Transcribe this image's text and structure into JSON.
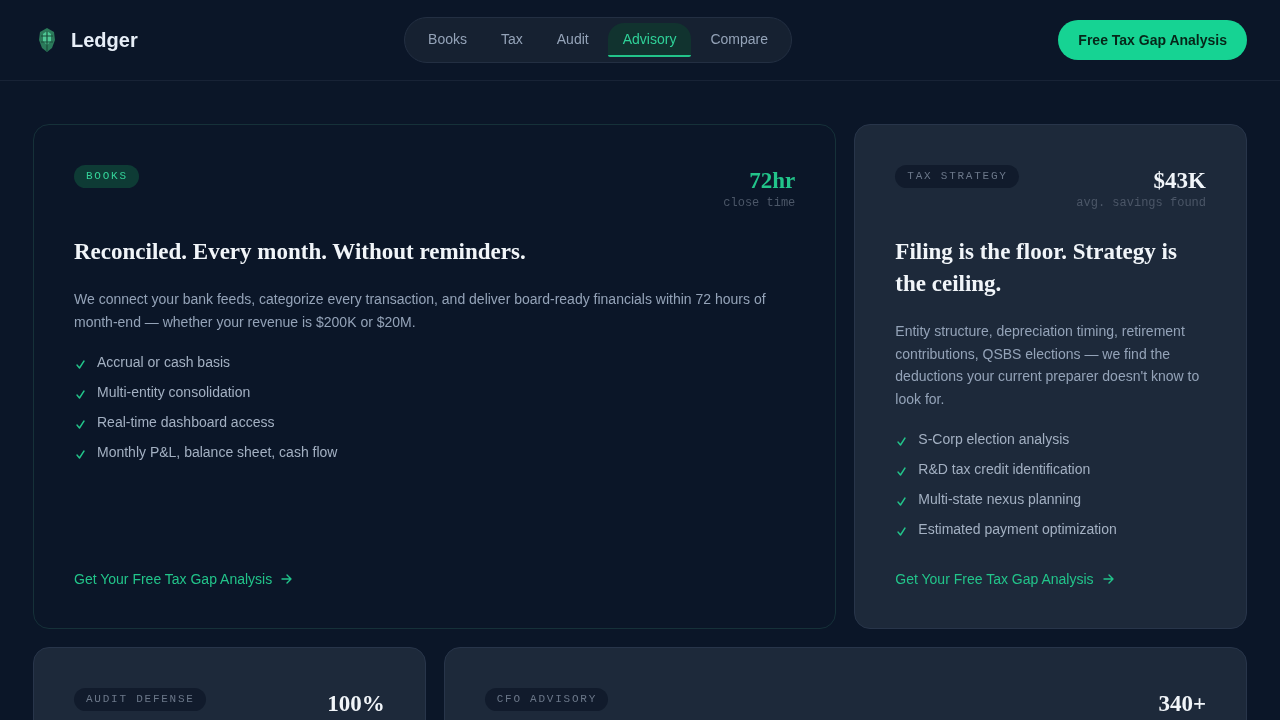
{
  "header": {
    "brand": "Ledger",
    "nav": [
      {
        "label": "Books",
        "selected": false
      },
      {
        "label": "Tax",
        "selected": false
      },
      {
        "label": "Audit",
        "selected": false
      },
      {
        "label": "Advisory",
        "selected": true
      },
      {
        "label": "Compare",
        "selected": false
      }
    ],
    "cta": "Free Tax Gap Analysis"
  },
  "cards": [
    {
      "highlighted": true,
      "wide": true,
      "tag": "BOOKS",
      "stat": "72hr",
      "stat_label": "close time",
      "title": "Reconciled. Every month. Without reminders.",
      "body": "We connect your bank feeds, categorize every transaction, and deliver board-ready financials within 72 hours of month-end — whether your revenue is $200K or $20M.",
      "features": [
        "Accrual or cash basis",
        "Multi-entity consolidation",
        "Real-time dashboard access",
        "Monthly P&L, balance sheet, cash flow"
      ],
      "link": "Get Your Free Tax Gap Analysis"
    },
    {
      "highlighted": false,
      "wide": false,
      "tag": "TAX STRATEGY",
      "stat": "$43K",
      "stat_label": "avg. savings found",
      "title": "Filing is the floor. Strategy is the ceiling.",
      "body": "Entity structure, depreciation timing, retirement contributions, QSBS elections — we find the deductions your current preparer doesn't know to look for.",
      "features": [
        "S-Corp election analysis",
        "R&D tax credit identification",
        "Multi-state nexus planning",
        "Estimated payment optimization"
      ],
      "link": "Get Your Free Tax Gap Analysis"
    },
    {
      "highlighted": false,
      "wide": false,
      "tag": "AUDIT DEFENSE",
      "stat": "100%"
    },
    {
      "highlighted": false,
      "wide": true,
      "tag": "CFO ADVISORY",
      "stat": "340+"
    }
  ]
}
